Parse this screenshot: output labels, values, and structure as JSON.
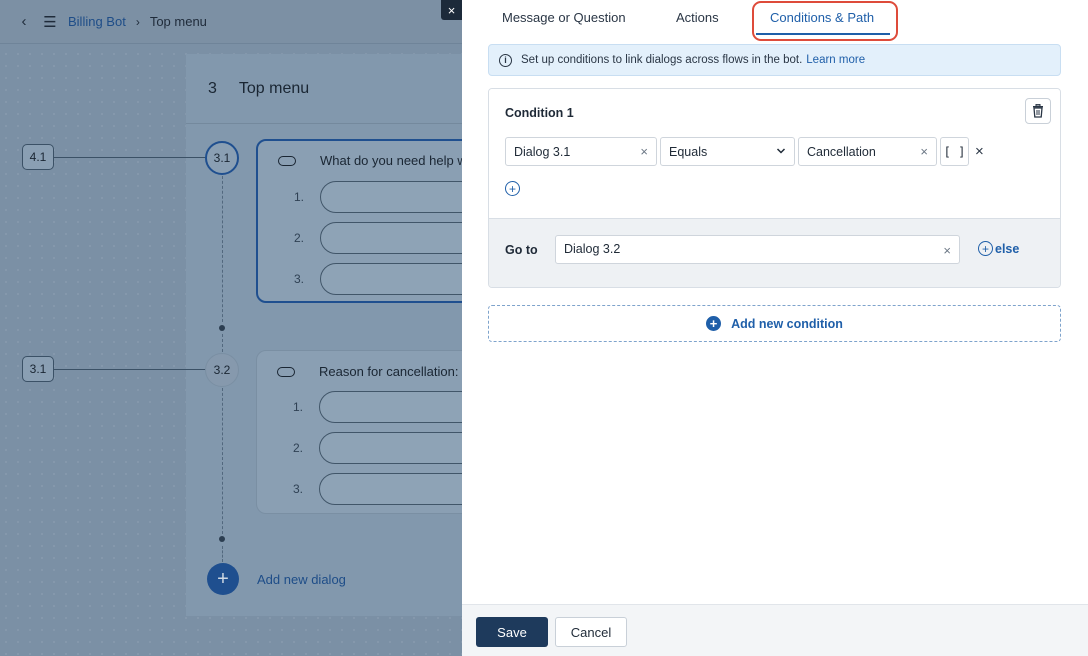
{
  "breadcrumb": {
    "bot_name": "Billing Bot",
    "current": "Top menu"
  },
  "flow": {
    "section_number": "3",
    "section_title": "Top menu",
    "nodes": [
      {
        "incoming_tag": "4.1",
        "id": "3.1",
        "question": "What do you need help w",
        "options": [
          "1.",
          "2.",
          "3."
        ]
      },
      {
        "incoming_tag": "3.1",
        "id": "3.2",
        "question": "Reason for cancellation:",
        "options": [
          "1.",
          "2.",
          "3."
        ]
      }
    ],
    "add_dialog_label": "Add new dialog"
  },
  "close_label": "×",
  "tabs": [
    {
      "label": "Message or Question"
    },
    {
      "label": "Actions"
    },
    {
      "label": "Conditions & Path"
    }
  ],
  "info": {
    "text": "Set up conditions to link dialogs across flows in the bot.",
    "link": "Learn more"
  },
  "condition": {
    "title": "Condition 1",
    "source": "Dialog 3.1",
    "operator": "Equals",
    "value": "Cancellation",
    "bracket_label": "[ ]",
    "goto_label": "Go to",
    "goto_target": "Dialog 3.2",
    "else_label": "else"
  },
  "add_condition_label": "Add new condition",
  "footer": {
    "save": "Save",
    "cancel": "Cancel"
  },
  "colors": {
    "accent": "#1f5fa9",
    "primary_button": "#1e3a5c",
    "highlight": "#de4b3a"
  }
}
